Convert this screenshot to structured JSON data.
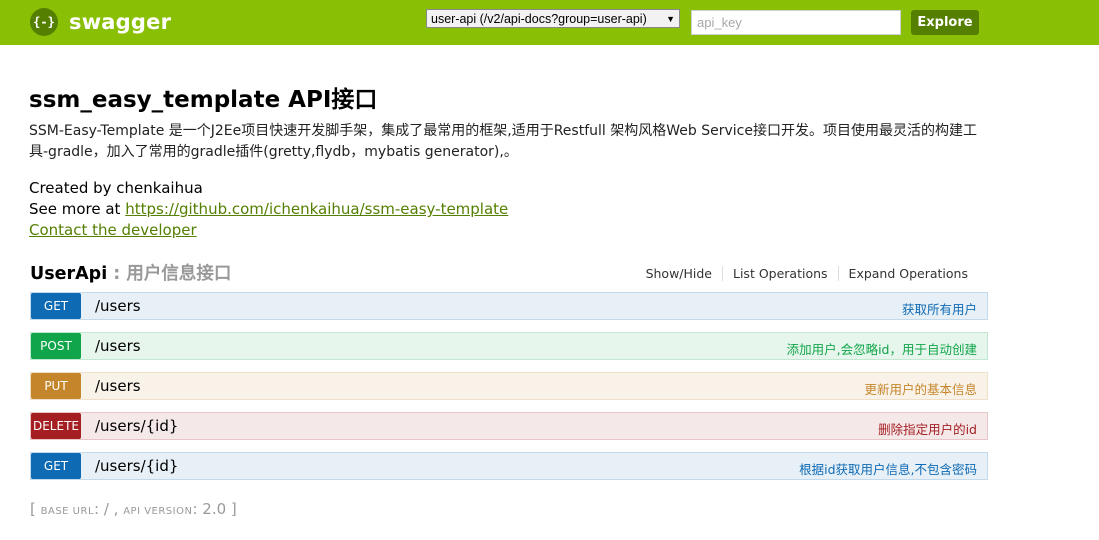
{
  "header": {
    "logo_glyph": "{-}",
    "logo_text": "swagger",
    "api_select_value": "user-api (/v2/api-docs?group=user-api)",
    "api_key_placeholder": "api_key",
    "explore_label": "Explore",
    "colors": {
      "bar": "#89bf04",
      "button": "#547f00"
    }
  },
  "info": {
    "title": "ssm_easy_template API接口",
    "description": "SSM-Easy-Template 是一个J2Ee项目快速开发脚手架，集成了最常用的框架,适用于Restfull 架构风格Web Service接口开发。项目使用最灵活的构建工具-gradle，加入了常用的gradle插件(gretty,flydb，mybatis generator),。",
    "created_by": "Created by chenkaihua",
    "see_more_prefix": "See more at ",
    "see_more_link": "https://github.com/ichenkaihua/ssm-easy-template",
    "contact": "Contact the developer"
  },
  "resource": {
    "name": "UserApi",
    "separator": " : ",
    "description": "用户信息接口",
    "actions": [
      "Show/Hide",
      "List Operations",
      "Expand Operations"
    ]
  },
  "operations": [
    {
      "method": "GET",
      "path": "/users",
      "summary": "获取所有用户"
    },
    {
      "method": "POST",
      "path": "/users",
      "summary": "添加用户,会忽略id，用于自动创建"
    },
    {
      "method": "PUT",
      "path": "/users",
      "summary": "更新用户的基本信息"
    },
    {
      "method": "DELETE",
      "path": "/users/{id}",
      "summary": "删除指定用户的id"
    },
    {
      "method": "GET",
      "path": "/users/{id}",
      "summary": "根据id获取用户信息,不包含密码"
    }
  ],
  "footer": {
    "open": "[ ",
    "base_url_label": "BASE URL",
    "base_url_value": ": / , ",
    "api_version_label": "API VERSION",
    "api_version_value": ": 2.0 ]"
  }
}
